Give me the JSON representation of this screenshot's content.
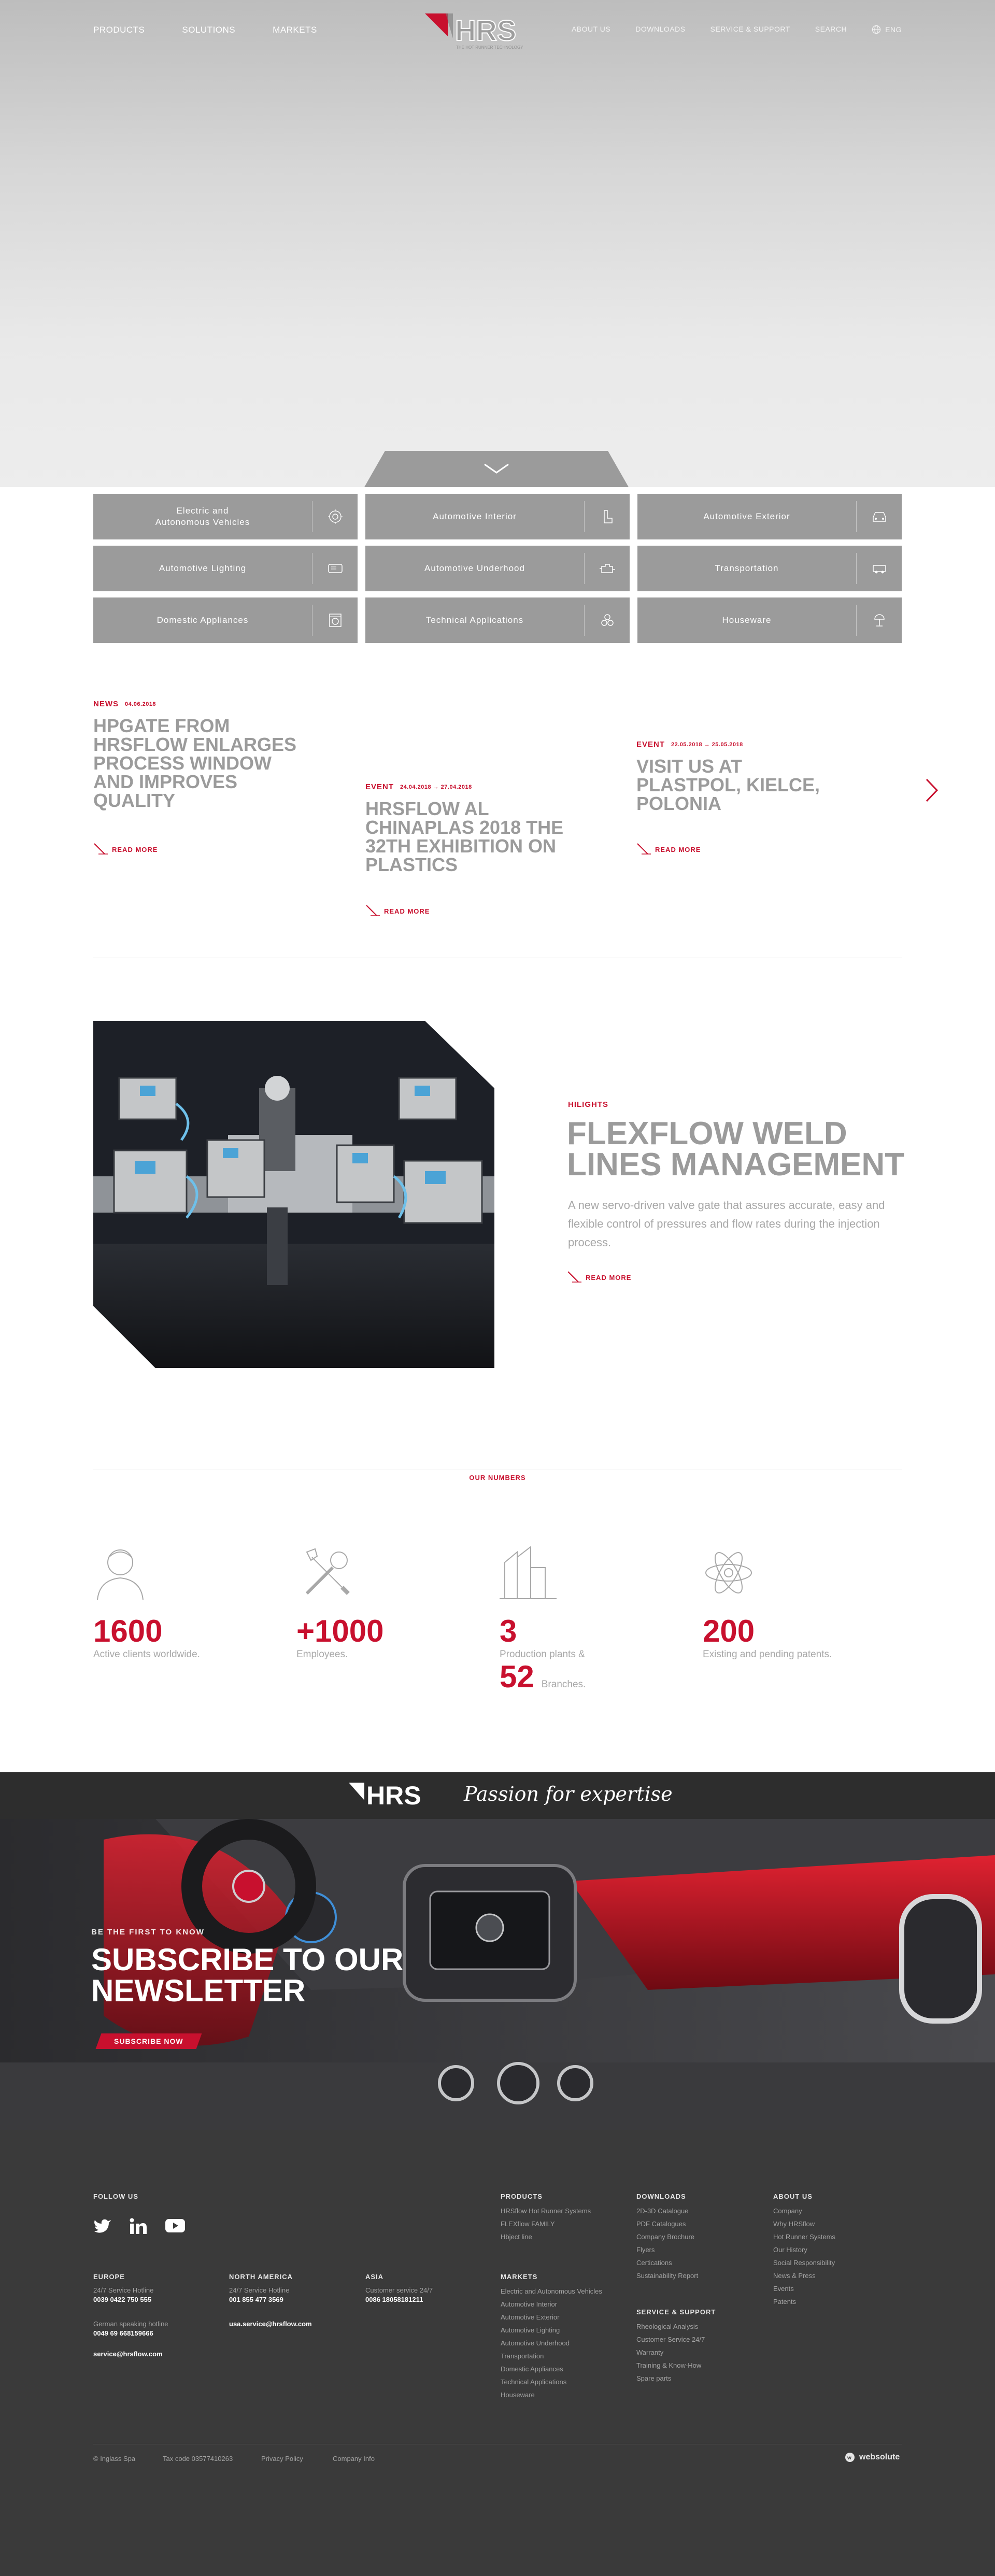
{
  "nav": {
    "left": [
      "PRODUCTS",
      "SOLUTIONS",
      "MARKETS"
    ],
    "right": [
      "ABOUT US",
      "DOWNLOADS",
      "SERVICE & SUPPORT",
      "SEARCH"
    ],
    "lang": "ENG"
  },
  "categories": [
    "Electric and Autonomous Vehicles",
    "Automotive Interior",
    "Automotive Exterior",
    "Automotive Lighting",
    "Automotive Underhood",
    "Transportation",
    "Domestic Appliances",
    "Technical Applications",
    "Houseware"
  ],
  "news": [
    {
      "type": "NEWS",
      "date": "04.06.2018",
      "title": "HPGATE FROM HRSFLOW ENLARGES PROCESS WINDOW AND IMPROVES QUALITY",
      "cta": "READ MORE"
    },
    {
      "type": "EVENT",
      "date": "24.04.2018 → 27.04.2018",
      "title": "HRSFLOW AL CHINAPLAS 2018 THE 32TH EXHIBITION ON PLASTICS",
      "cta": "READ MORE"
    },
    {
      "type": "EVENT",
      "date": "22.05.2018 → 25.05.2018",
      "title": "VISIT US AT PLASTPOL, KIELCE, POLONIA",
      "cta": "READ MORE"
    }
  ],
  "highlight": {
    "kicker": "HILIGHTS",
    "title": "FLEXFLOW WELD LINES MANAGEMENT",
    "description": "A new servo-driven valve gate that assures accurate, easy and flexible control of pressures and flow rates during the injection process.",
    "cta": "READ MORE"
  },
  "numbers": {
    "label": "OUR NUMBERS",
    "items": [
      {
        "value": "1600",
        "text": "Active clients worldwide.",
        "icon": "person-icon"
      },
      {
        "value": "+1000",
        "text": "Employees.",
        "icon": "tools-icon"
      },
      {
        "value": "3",
        "text": "Production plants &",
        "value2": "52",
        "text2": "Branches.",
        "icon": "buildings-icon"
      },
      {
        "value": "200",
        "text": "Existing and pending patents.",
        "icon": "atom-icon"
      }
    ]
  },
  "banner": {
    "logo": "HRS",
    "tagline": "Passion for expertise"
  },
  "newsletter": {
    "kicker": "BE THE FIRST TO KNOW",
    "title": "SUBSCRIBE TO OUR NEWSLETTER",
    "button": "SUBSCRIBE NOW"
  },
  "footer": {
    "follow": "FOLLOW US",
    "europe": {
      "heading": "EUROPE",
      "hotline_label": "24/7 Service Hotline",
      "hotline": "0039 0422 750 555",
      "german_label": "German speaking hotline",
      "german": "0049 69 668159666",
      "email": "service@hrsflow.com"
    },
    "north_america": {
      "heading": "NORTH AMERICA",
      "hotline_label": "24/7 Service Hotline",
      "hotline": "001 855 477 3569",
      "email": "usa.service@hrsflow.com"
    },
    "asia": {
      "heading": "ASIA",
      "hotline_label": "Customer service 24/7",
      "hotline": "0086 18058181211"
    },
    "products": {
      "heading": "PRODUCTS",
      "items": [
        "HRSflow Hot Runner Systems",
        "FLEXflow FAMILY",
        "Hbject line"
      ]
    },
    "markets": {
      "heading": "MARKETS",
      "items": [
        "Electric and Autonomous Vehicles",
        "Automotive Interior",
        "Automotive Exterior",
        "Automotive Lighting",
        "Automotive Underhood",
        "Transportation",
        "Domestic Appliances",
        "Technical Applications",
        "Houseware"
      ]
    },
    "downloads": {
      "heading": "DOWNLOADS",
      "items": [
        "2D-3D Catalogue",
        "PDF Catalogues",
        "Company Brochure",
        "Flyers",
        "Certications",
        "Sustainability Report"
      ]
    },
    "service": {
      "heading": "SERVICE & SUPPORT",
      "items": [
        "Rheological Analysis",
        "Customer Service 24/7",
        "Warranty",
        "Training & Know-How",
        "Spare parts"
      ]
    },
    "about": {
      "heading": "ABOUT US",
      "items": [
        "Company",
        "Why HRSflow",
        "Hot Runner Systems",
        "Our History",
        "Social Responsibility",
        "News & Press",
        "Events",
        "Patents"
      ]
    },
    "bottom": [
      "© Inglass Spa",
      "Tax code 03577410263",
      "Privacy Policy",
      "Company Info"
    ],
    "credit": "websolute"
  }
}
